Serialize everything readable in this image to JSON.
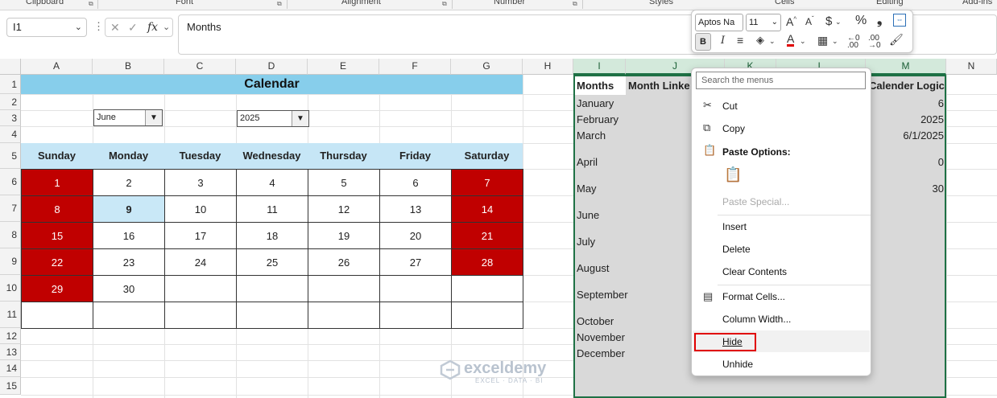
{
  "ribbon": {
    "groups": [
      "Clipboard",
      "Font",
      "Alignment",
      "Number",
      "Styles",
      "Cells",
      "Editing",
      "Add-ins"
    ]
  },
  "formula_bar": {
    "name_box": "I1",
    "fx_label": "fx",
    "formula": "Months"
  },
  "columns": [
    "A",
    "B",
    "C",
    "D",
    "E",
    "F",
    "G",
    "H",
    "I",
    "J",
    "K",
    "L",
    "M",
    "N"
  ],
  "rows": [
    "1",
    "2",
    "3",
    "4",
    "5",
    "6",
    "7",
    "8",
    "9",
    "10",
    "11",
    "12",
    "13",
    "14",
    "15"
  ],
  "calendar": {
    "title": "Calendar",
    "month_dropdown": "June",
    "year_dropdown": "2025",
    "day_headers": [
      "Sunday",
      "Monday",
      "Tuesday",
      "Wednesday",
      "Thursday",
      "Friday",
      "Saturday"
    ],
    "weeks": [
      [
        "1",
        "2",
        "3",
        "4",
        "5",
        "6",
        "7"
      ],
      [
        "8",
        "9",
        "10",
        "11",
        "12",
        "13",
        "14"
      ],
      [
        "15",
        "16",
        "17",
        "18",
        "19",
        "20",
        "21"
      ],
      [
        "22",
        "23",
        "24",
        "25",
        "26",
        "27",
        "28"
      ],
      [
        "29",
        "30",
        "",
        "",
        "",
        "",
        ""
      ],
      [
        "",
        "",
        "",
        "",
        "",
        "",
        ""
      ]
    ],
    "highlight_color": "#c00000",
    "today_color": "#c9e8f7"
  },
  "sheet": {
    "col_i": [
      "Months",
      "January",
      "February",
      "March",
      "April",
      "May",
      "June",
      "July",
      "August",
      "September",
      "October",
      "November",
      "December"
    ],
    "col_j_header": "Month Linke",
    "col_m": [
      "Calender Logic",
      "6",
      "2025",
      "6/1/2025",
      "0",
      "30"
    ]
  },
  "mini_toolbar": {
    "font_name": "Aptos Na",
    "font_size": "11",
    "bold": "B",
    "italic": "I"
  },
  "context_menu": {
    "search_placeholder": "Search the menus",
    "cut": "Cut",
    "copy": "Copy",
    "paste_options": "Paste Options:",
    "paste_special": "Paste Special...",
    "insert": "Insert",
    "delete": "Delete",
    "clear_contents": "Clear Contents",
    "format_cells": "Format Cells...",
    "column_width": "Column Width...",
    "hide": "Hide",
    "unhide": "Unhide"
  },
  "watermark": {
    "name": "exceldemy",
    "tagline": "EXCEL · DATA · BI"
  }
}
